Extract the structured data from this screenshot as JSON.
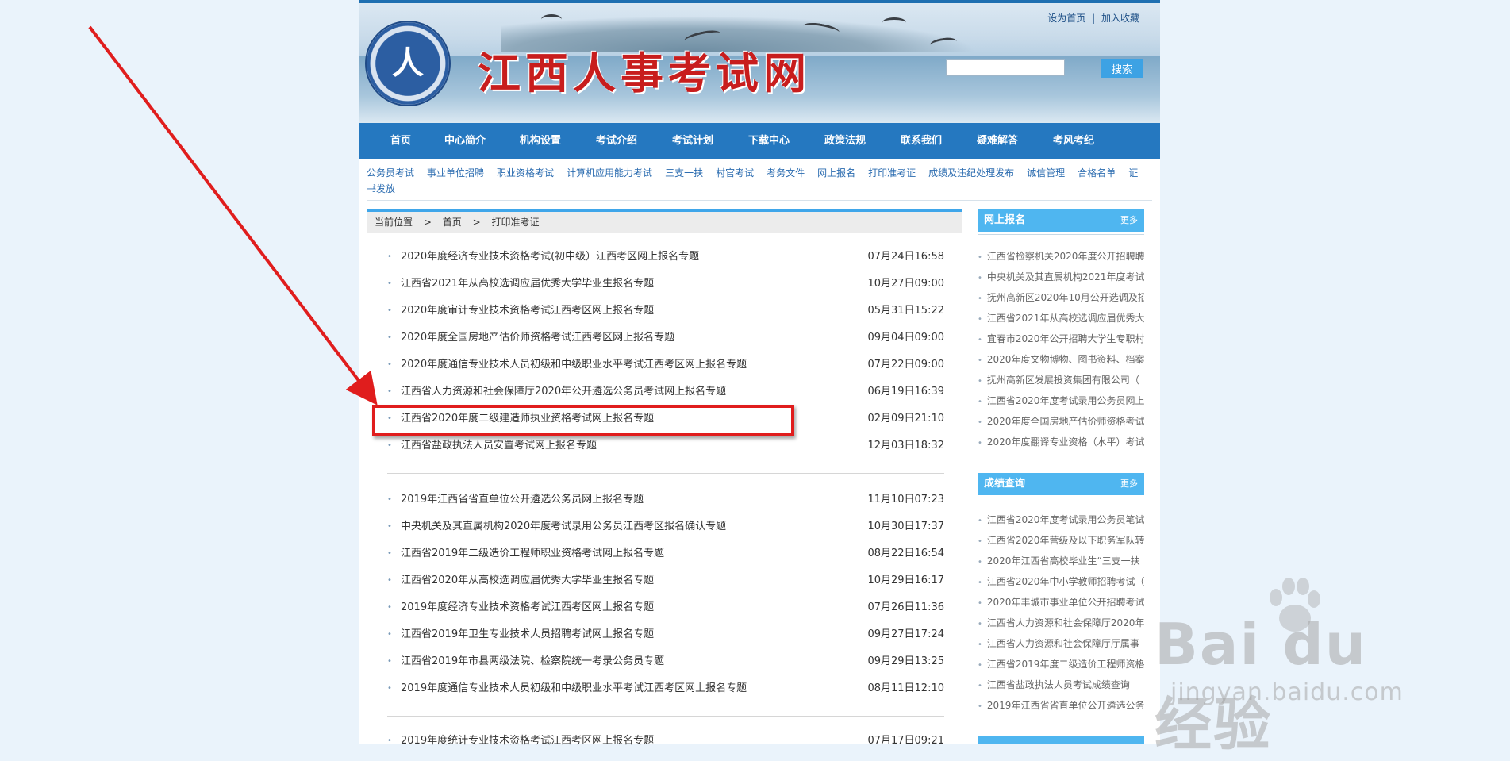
{
  "header": {
    "site_title": "江西人事考试网",
    "set_home": "设为首页",
    "separator": "|",
    "add_favorite": "加入收藏",
    "search_placeholder": "",
    "search_button": "搜索"
  },
  "nav": [
    "首页",
    "中心简介",
    "机构设置",
    "考试介绍",
    "考试计划",
    "下载中心",
    "政策法规",
    "联系我们",
    "疑难解答",
    "考风考纪"
  ],
  "subnav": [
    "公务员考试",
    "事业单位招聘",
    "职业资格考试",
    "计算机应用能力考试",
    "三支一扶",
    "村官考试",
    "考务文件",
    "网上报名",
    "打印准考证",
    "成绩及违纪处理发布",
    "诚信管理",
    "合格名单",
    "证书发放"
  ],
  "breadcrumb": {
    "label": "当前位置",
    "sep1": ">",
    "home": "首页",
    "sep2": ">",
    "current": "打印准考证"
  },
  "groups": [
    [
      {
        "title": "2020年度经济专业技术资格考试(初中级）江西考区网上报名专题",
        "date": "07月24日16:58"
      },
      {
        "title": "江西省2021年从高校选调应届优秀大学毕业生报名专题",
        "date": "10月27日09:00"
      },
      {
        "title": "2020年度审计专业技术资格考试江西考区网上报名专题",
        "date": "05月31日15:22"
      },
      {
        "title": "2020年度全国房地产估价师资格考试江西考区网上报名专题",
        "date": "09月04日09:00"
      },
      {
        "title": "2020年度通信专业技术人员初级和中级职业水平考试江西考区网上报名专题",
        "date": "07月22日09:00"
      },
      {
        "title": "江西省人力资源和社会保障厅2020年公开遴选公务员考试网上报名专题",
        "date": "06月19日16:39"
      },
      {
        "title": "江西省2020年度二级建造师执业资格考试网上报名专题",
        "date": "02月09日21:10"
      },
      {
        "title": "江西省盐政执法人员安置考试网上报名专题",
        "date": "12月03日18:32"
      }
    ],
    [
      {
        "title": "2019年江西省省直单位公开遴选公务员网上报名专题",
        "date": "11月10日07:23"
      },
      {
        "title": "中央机关及其直属机构2020年度考试录用公务员江西考区报名确认专题",
        "date": "10月30日17:37"
      },
      {
        "title": "江西省2019年二级造价工程师职业资格考试网上报名专题",
        "date": "08月22日16:54"
      },
      {
        "title": "江西省2020年从高校选调应届优秀大学毕业生报名专题",
        "date": "10月29日16:17"
      },
      {
        "title": "2019年度经济专业技术资格考试江西考区网上报名专题",
        "date": "07月26日11:36"
      },
      {
        "title": "江西省2019年卫生专业技术人员招聘考试网上报名专题",
        "date": "09月27日17:24"
      },
      {
        "title": "江西省2019年市县两级法院、检察院统一考录公务员专题",
        "date": "09月29日13:25"
      },
      {
        "title": "2019年度通信专业技术人员初级和中级职业水平考试江西考区网上报名专题",
        "date": "08月11日12:10"
      }
    ],
    [
      {
        "title": "2019年度统计专业技术资格考试江西考区网上报名专题",
        "date": "07月17日09:21"
      }
    ]
  ],
  "sidebar": {
    "online_signup": {
      "title": "网上报名",
      "more": "更多",
      "items": [
        "江西省检察机关2020年度公开招聘聘",
        "中央机关及其直属机构2021年度考试",
        "抚州高新区2020年10月公开选调及招",
        "江西省2021年从高校选调应届优秀大",
        "宜春市2020年公开招聘大学生专职村",
        "2020年度文物博物、图书资料、档案",
        "抚州高新区发展投资集团有限公司（",
        "江西省2020年度考试录用公务员网上",
        "2020年度全国房地产估价师资格考试",
        "2020年度翻译专业资格（水平）考试"
      ]
    },
    "score_query": {
      "title": "成绩查询",
      "more": "更多",
      "items": [
        "江西省2020年度考试录用公务员笔试",
        "江西省2020年营级及以下职务军队转",
        "2020年江西省高校毕业生“三支一扶",
        "江西省2020年中小学教师招聘考试（",
        "2020年丰城市事业单位公开招聘考试",
        "江西省人力资源和社会保障厅2020年",
        "江西省人力资源和社会保障厅厅属事",
        "江西省2019年度二级造价工程师资格",
        "江西省盐政执法人员考试成绩查询",
        "2019年江西省省直单位公开遴选公务"
      ]
    }
  },
  "watermark": {
    "brand": "Bai du 经验",
    "url": "jingyan.baidu.com"
  },
  "colors": {
    "nav": "#2578c0",
    "accent": "#4fb6f0",
    "annotation": "#e01d1d",
    "title_red": "#c81d1d",
    "background": "#eaf3fb"
  }
}
